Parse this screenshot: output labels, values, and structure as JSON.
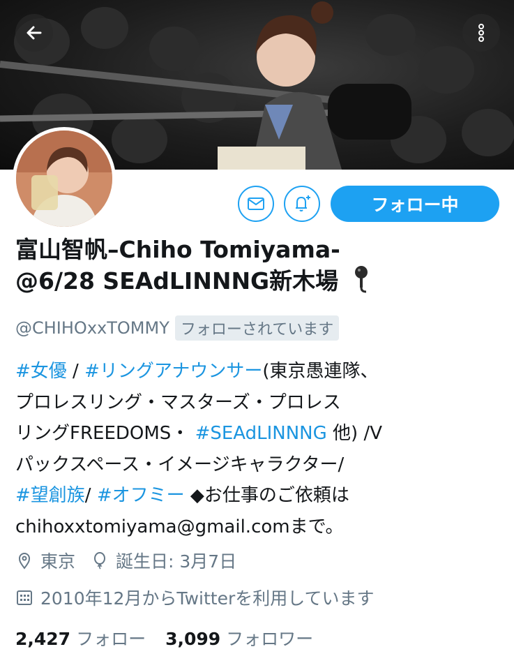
{
  "nav": {
    "back_icon": "arrow-left-icon",
    "more_icon": "more-vertical-icon"
  },
  "profile": {
    "follow_button_label": "フォロー中",
    "name_line1": "富山智帆–Chiho Tomiyama-",
    "name_line2": "@6/28 SEAdLINNNG新木場",
    "name_emoji": "microphone-icon",
    "handle": "@CHIHOxxTOMMY",
    "follows_you_badge": "フォローされています"
  },
  "bio": {
    "l1_tag1": "#女優",
    "l1_sep": " / ",
    "l1_tag2": "#リングアナウンサー",
    "l1_rest": "(東京愚連隊、",
    "l2": "プロレスリング・マスターズ・プロレス",
    "l3_pre": "リングFREEDOMS・ ",
    "l3_tag": "#SEAdLINNNG",
    "l3_post": " 他) /V",
    "l4": "パックスペース・イメージキャラクター/",
    "l5_tag1": "#望創族",
    "l5_sep": "/ ",
    "l5_tag2": "#オフミー",
    "l5_rest": " ◆お仕事のご依頼は",
    "l6": "chihoxxtomiyama@gmail.comまで。"
  },
  "meta": {
    "location": "東京",
    "birthday": "誕生日: 3月7日",
    "joined": "2010年12月からTwitterを利用しています"
  },
  "stats": {
    "following_count": "2,427",
    "following_label": "フォロー",
    "followers_count": "3,099",
    "followers_label": "フォロワー"
  },
  "colors": {
    "accent": "#1da1f2",
    "link": "#1b95e0",
    "secondary_text": "#657786"
  }
}
